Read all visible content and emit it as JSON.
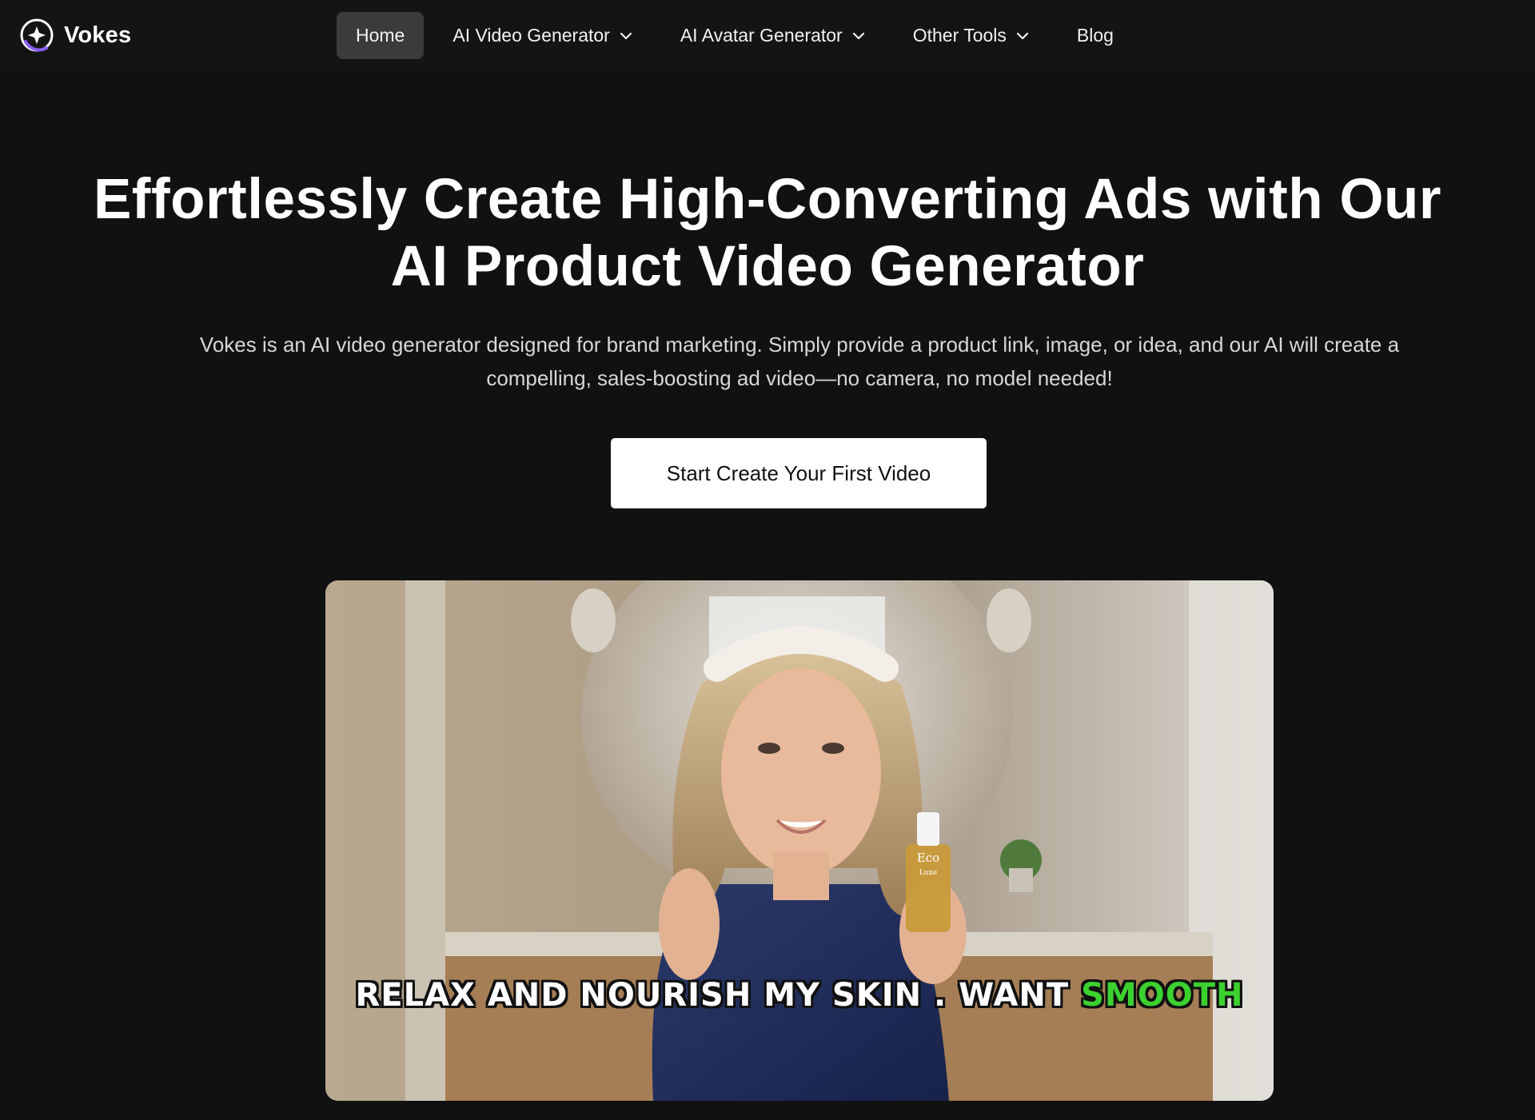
{
  "brand": {
    "name": "Vokes",
    "logo_icon": "spark-orbit-logo-icon",
    "accent": "#8b5cf6"
  },
  "nav": {
    "items": [
      {
        "label": "Home",
        "active": true,
        "dropdown": false
      },
      {
        "label": "AI Video Generator",
        "active": false,
        "dropdown": true
      },
      {
        "label": "AI Avatar Generator",
        "active": false,
        "dropdown": true
      },
      {
        "label": "Other Tools",
        "active": false,
        "dropdown": true
      },
      {
        "label": "Blog",
        "active": false,
        "dropdown": false
      }
    ]
  },
  "hero": {
    "title_line1": "Effortlessly Create High-Converting Ads with Our",
    "title_line2": "AI Product Video Generator",
    "subtitle_line1": "Vokes is an AI video generator designed for brand marketing. Simply provide a product link, image, or idea, and our AI will create a",
    "subtitle_line2": "compelling, sales-boosting ad video—no camera, no model needed!",
    "cta_label": "Start Create Your First Video"
  },
  "video": {
    "caption_main": "RELAX AND NOURISH MY SKIN . WANT ",
    "caption_highlight": "SMOOTH",
    "caption_highlight_color": "#3bd12f",
    "product_label_brand": "Eco",
    "product_label_sub": "Luxe"
  },
  "colors": {
    "page_bg": "#111111",
    "nav_active_bg": "#3b3b3b",
    "cta_bg": "#ffffff"
  }
}
